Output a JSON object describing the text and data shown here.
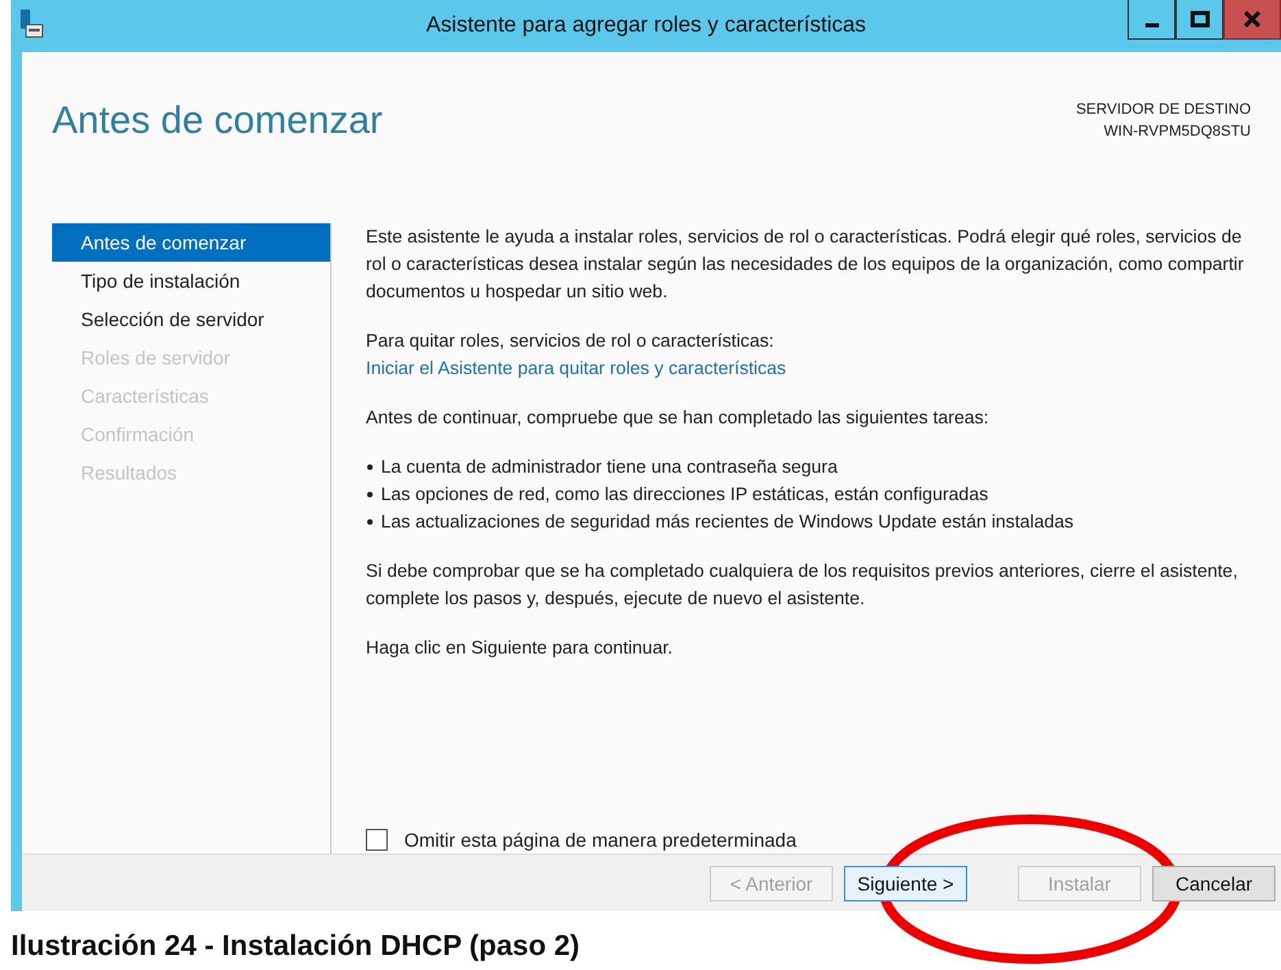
{
  "window": {
    "title": "Asistente para agregar roles y características"
  },
  "header": {
    "title": "Antes de comenzar",
    "target_label": "SERVIDOR DE DESTINO",
    "target_name": "WIN-RVPM5DQ8STU"
  },
  "nav": [
    {
      "label": "Antes de comenzar",
      "selected": true,
      "disabled": false
    },
    {
      "label": "Tipo de instalación",
      "selected": false,
      "disabled": false
    },
    {
      "label": "Selección de servidor",
      "selected": false,
      "disabled": false
    },
    {
      "label": "Roles de servidor",
      "selected": false,
      "disabled": true
    },
    {
      "label": "Características",
      "selected": false,
      "disabled": true
    },
    {
      "label": "Confirmación",
      "selected": false,
      "disabled": true
    },
    {
      "label": "Resultados",
      "selected": false,
      "disabled": true
    }
  ],
  "content": [
    {
      "kind": "text",
      "text": "Este asistente le ayuda a instalar roles, servicios de rol o características. Podrá elegir qué roles, servicios de rol o características desea instalar según las necesidades de los equipos de la organización, como compartir documentos u hospedar un sitio web."
    },
    {
      "kind": "label",
      "text": "Para quitar roles, servicios de rol o características:"
    },
    {
      "kind": "link",
      "text": "Iniciar el Asistente para quitar roles y características"
    },
    {
      "kind": "text",
      "text": "Antes de continuar, compruebe que se han completado las siguientes tareas:"
    },
    {
      "kind": "bullets",
      "items": [
        "La cuenta de administrador tiene una contraseña segura",
        "Las opciones de red, como las direcciones IP estáticas, están configuradas",
        "Las actualizaciones de seguridad más recientes de Windows Update están instaladas"
      ]
    },
    {
      "kind": "text",
      "text": "Si debe comprobar que se ha completado cualquiera de los requisitos previos anteriores, cierre el asistente, complete los pasos y, después, ejecute de nuevo el asistente."
    },
    {
      "kind": "text",
      "text": "Haga clic en Siguiente para continuar."
    }
  ],
  "checkbox": {
    "label": "Omitir esta página de manera predeterminada",
    "checked": false
  },
  "buttons": [
    {
      "label": "< Anterior",
      "disabled": true,
      "default": false
    },
    {
      "label": "Siguiente >",
      "disabled": false,
      "default": true
    },
    {
      "label": "Instalar",
      "disabled": true,
      "default": false
    },
    {
      "label": "Cancelar",
      "disabled": false,
      "default": false
    }
  ],
  "caption": "Ilustración 24 - Instalación DHCP (paso 2)"
}
